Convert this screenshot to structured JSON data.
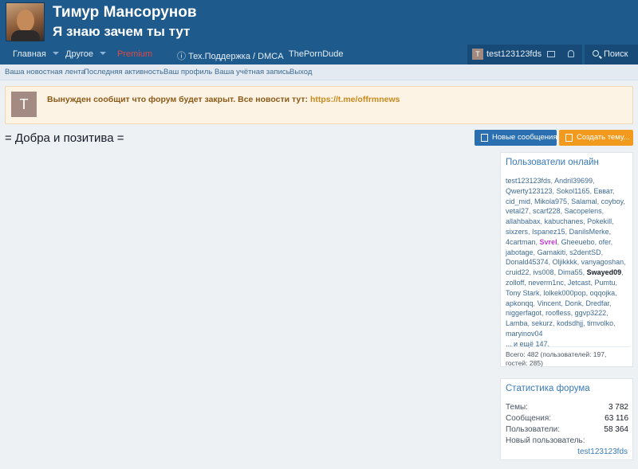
{
  "header": {
    "title": "Тимур Мансорунов",
    "subtitle": "Я знаю зачем ты тут"
  },
  "nav": {
    "items": [
      {
        "label": "Главная"
      },
      {
        "label": "Другое"
      },
      {
        "label": "Premium"
      },
      {
        "label": "Тех.Поддержка / DMCA"
      },
      {
        "label": "ThePornDude"
      }
    ],
    "user": {
      "avatar_letter": "T",
      "name": "test123123fds"
    },
    "search_label": "Поиск"
  },
  "subnav": {
    "links": [
      "Ваша новостная лента",
      "Последняя активность",
      "Ваш профиль",
      "Ваша учётная запись",
      "Выход"
    ]
  },
  "notice": {
    "avatar_letter": "T",
    "text": "Вынужден сообщит что форум будет закрыт. Все новости тут:",
    "link": "https://t.me/offrmnews"
  },
  "page": {
    "title": "= Добра и позитива ="
  },
  "buttons": {
    "new_posts": "Новые сообщения",
    "create_thread": "Создать тему..."
  },
  "online": {
    "title": "Пользователи онлайн",
    "users": [
      "test123123fds",
      "Andril39699",
      "Qwerty123123",
      "Sokol1165",
      "Eвват",
      "cid_mid",
      "Mikola975",
      "Salamal",
      "coyboy",
      "vetal27",
      "scarf228",
      "Sacopelens",
      "allahbabax",
      "kabuchanes",
      "Pokekill",
      "sixzers",
      "Ispanez15",
      "DanilsMerke",
      "4cartman",
      "Svrel",
      "Gheeuebo",
      "ofer",
      "jabotage",
      "Gamakiti",
      "s2dentSD",
      "Donald45374",
      "Oljikkkk",
      "vanyagoshan",
      "cruid22",
      "ivs008",
      "Dima55",
      "Swayed09",
      "zolloff",
      "neverm1nc",
      "Jetcast",
      "Pumtu",
      "Tony Stark",
      "lolkek000pop",
      "oqqojka",
      "apkonqq",
      "Vincent",
      "Donk",
      "Dredfar",
      "niggerfagot",
      "roofless",
      "ggvp3222",
      "Lamba",
      "sekurz",
      "kodsdhjj",
      "timvolko",
      "maryinov04"
    ],
    "more": "... и ещё 147.",
    "total": "Всего: 482 (пользователей: 197, гостей: 285)"
  },
  "stats": {
    "title": "Статистика форума",
    "rows": [
      {
        "label": "Темы:",
        "value": "3 782"
      },
      {
        "label": "Сообщения:",
        "value": "63 116"
      },
      {
        "label": "Пользователи:",
        "value": "58 364"
      },
      {
        "label": "Новый пользователь:",
        "value": ""
      }
    ],
    "newest_user": "test123123fds"
  }
}
